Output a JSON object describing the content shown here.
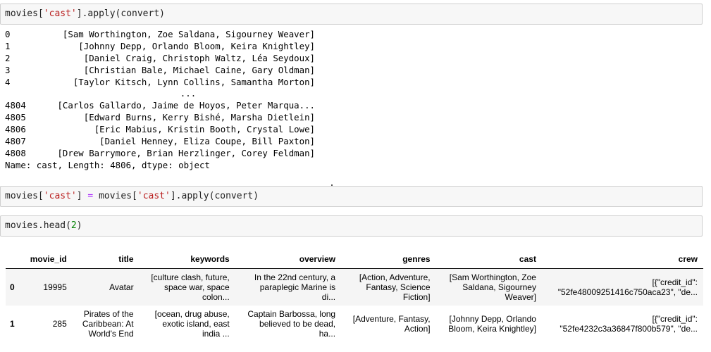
{
  "cells": [
    {
      "code": [
        {
          "t": "movies["
        },
        {
          "t": "'cast'",
          "c": "str"
        },
        {
          "t": "].apply(convert)"
        }
      ]
    },
    {
      "code": [
        {
          "t": "movies["
        },
        {
          "t": "'cast'",
          "c": "str"
        },
        {
          "t": "] "
        },
        {
          "t": "=",
          "c": "op"
        },
        {
          "t": " movies["
        },
        {
          "t": "'cast'",
          "c": "str"
        },
        {
          "t": "].apply(convert)"
        }
      ]
    },
    {
      "code": [
        {
          "t": "movies.head("
        },
        {
          "t": "2",
          "c": "num"
        },
        {
          "t": ")"
        }
      ]
    }
  ],
  "series_output": {
    "rows_head": [
      {
        "idx": "0",
        "val": "[Sam Worthington, Zoe Saldana, Sigourney Weaver]"
      },
      {
        "idx": "1",
        "val": "[Johnny Depp, Orlando Bloom, Keira Knightley]"
      },
      {
        "idx": "2",
        "val": "[Daniel Craig, Christoph Waltz, Léa Seydoux]"
      },
      {
        "idx": "3",
        "val": "[Christian Bale, Michael Caine, Gary Oldman]"
      },
      {
        "idx": "4",
        "val": "[Taylor Kitsch, Lynn Collins, Samantha Morton]"
      }
    ],
    "ellipsis": "...",
    "rows_tail": [
      {
        "idx": "4804",
        "val": "[Carlos Gallardo, Jaime de Hoyos, Peter Marqua..."
      },
      {
        "idx": "4805",
        "val": "[Edward Burns, Kerry Bishé, Marsha Dietlein]"
      },
      {
        "idx": "4806",
        "val": "[Eric Mabius, Kristin Booth, Crystal Lowe]"
      },
      {
        "idx": "4807",
        "val": "[Daniel Henney, Eliza Coupe, Bill Paxton]"
      },
      {
        "idx": "4808",
        "val": "[Drew Barrymore, Brian Herzlinger, Corey Feldman]"
      }
    ],
    "footer": "Name: cast, Length: 4806, dtype: object"
  },
  "dataframe": {
    "columns": [
      "",
      "movie_id",
      "title",
      "keywords",
      "overview",
      "genres",
      "cast",
      "crew"
    ],
    "rows": [
      [
        "0",
        "19995",
        "Avatar",
        "[culture clash, future,\nspace war, space\ncolon...",
        "In the 22nd century, a\nparaplegic Marine is\ndi...",
        "[Action, Adventure,\nFantasy, Science\nFiction]",
        "[Sam Worthington, Zoe\nSaldana, Sigourney\nWeaver]",
        "[{\"credit_id\":\n\"52fe48009251416c750aca23\", \"de..."
      ],
      [
        "1",
        "285",
        "Pirates of the\nCaribbean: At\nWorld's End",
        "[ocean, drug abuse,\nexotic island, east\nindia ...",
        "Captain Barbossa, long\nbelieved to be dead,\nha...",
        "[Adventure, Fantasy,\nAction]",
        "[Johnny Depp, Orlando\nBloom, Keira Knightley]",
        "[{\"credit_id\":\n\"52fe4232c3a36847f800b579\", \"de..."
      ]
    ]
  }
}
